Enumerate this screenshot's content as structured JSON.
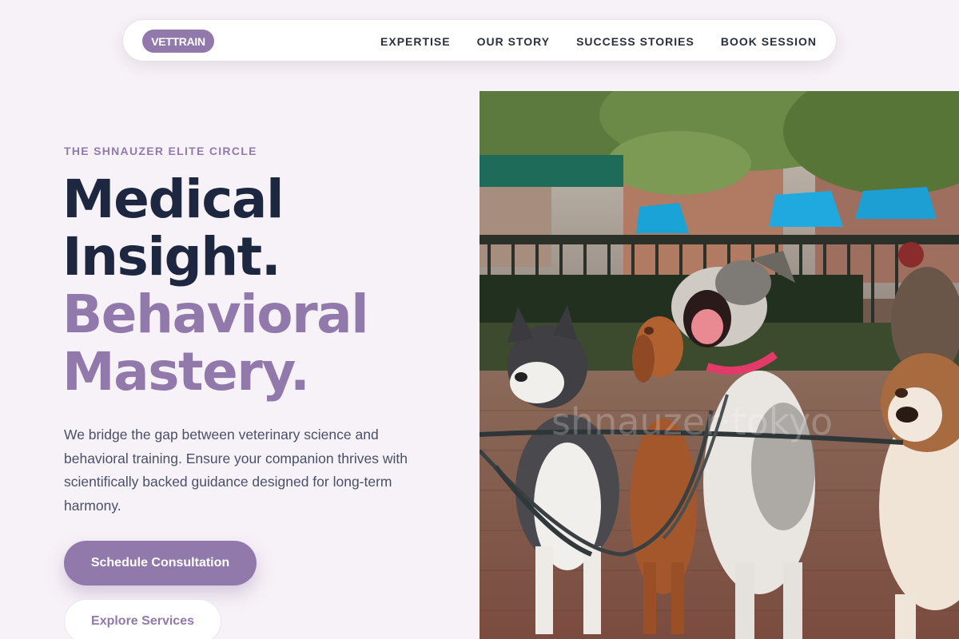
{
  "nav": {
    "brand": "VETTRAIN",
    "links": [
      "EXPERTISE",
      "OUR STORY",
      "SUCCESS STORIES",
      "BOOK SESSION"
    ]
  },
  "hero": {
    "eyebrow": "THE SHNAUZER ELITE CIRCLE",
    "headline_line1": "Medical",
    "headline_line2": "Insight.",
    "headline_line3": "Behavioral",
    "headline_line4": "Mastery.",
    "lead": "We bridge the gap between veterinary science and behavioral training. Ensure your companion thrives with scientifically backed guidance designed for long-term harmony.",
    "primary_cta": "Schedule Consultation",
    "secondary_cta": "Explore Services",
    "image_watermark": "shnauzer·tokyo"
  },
  "colors": {
    "accent": "#9279ab",
    "heading": "#1e2740",
    "body_text": "#48506a",
    "background": "#f7f2f7"
  }
}
